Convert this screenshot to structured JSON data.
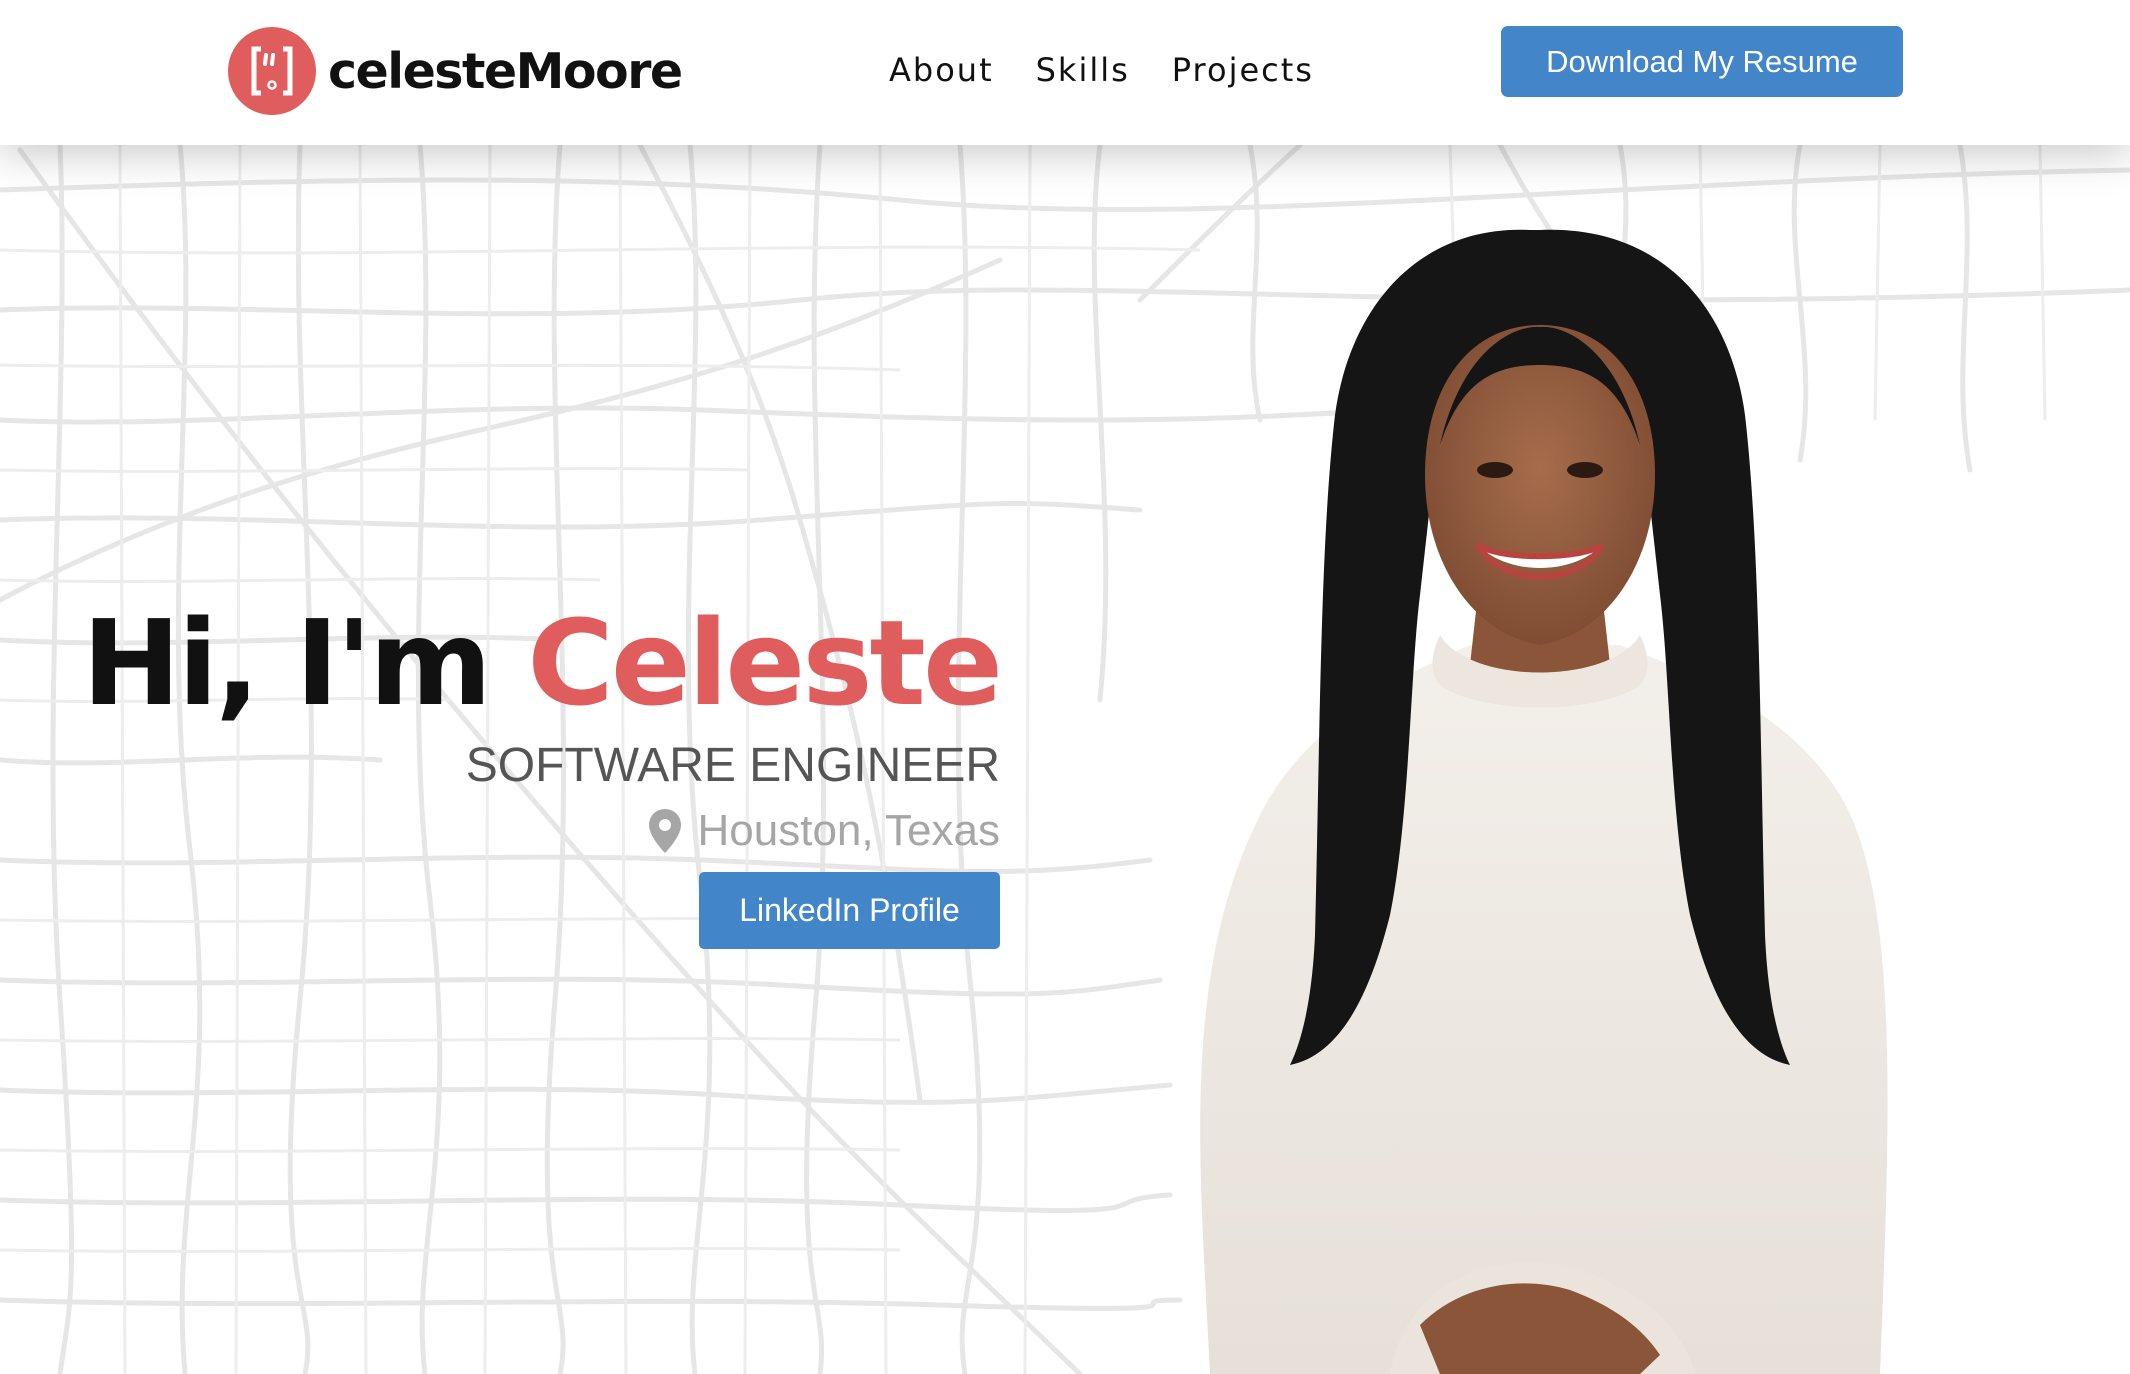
{
  "header": {
    "brand_name": "celesteMoore",
    "nav": [
      {
        "label": "About"
      },
      {
        "label": "Skills"
      },
      {
        "label": "Projects"
      }
    ],
    "resume_button": "Download My Resume"
  },
  "hero": {
    "greeting": "Hi, I'm",
    "name": "Celeste",
    "role": "SOFTWARE ENGINEER",
    "location": "Houston, Texas",
    "linkedin_button": "LinkedIn Profile"
  },
  "colors": {
    "accent": "#e05d5d",
    "button": "#4285c8",
    "text": "#111111",
    "muted": "#a6a6a6"
  },
  "icons": {
    "brand": "phone-quote-icon",
    "location": "map-pin-icon"
  }
}
